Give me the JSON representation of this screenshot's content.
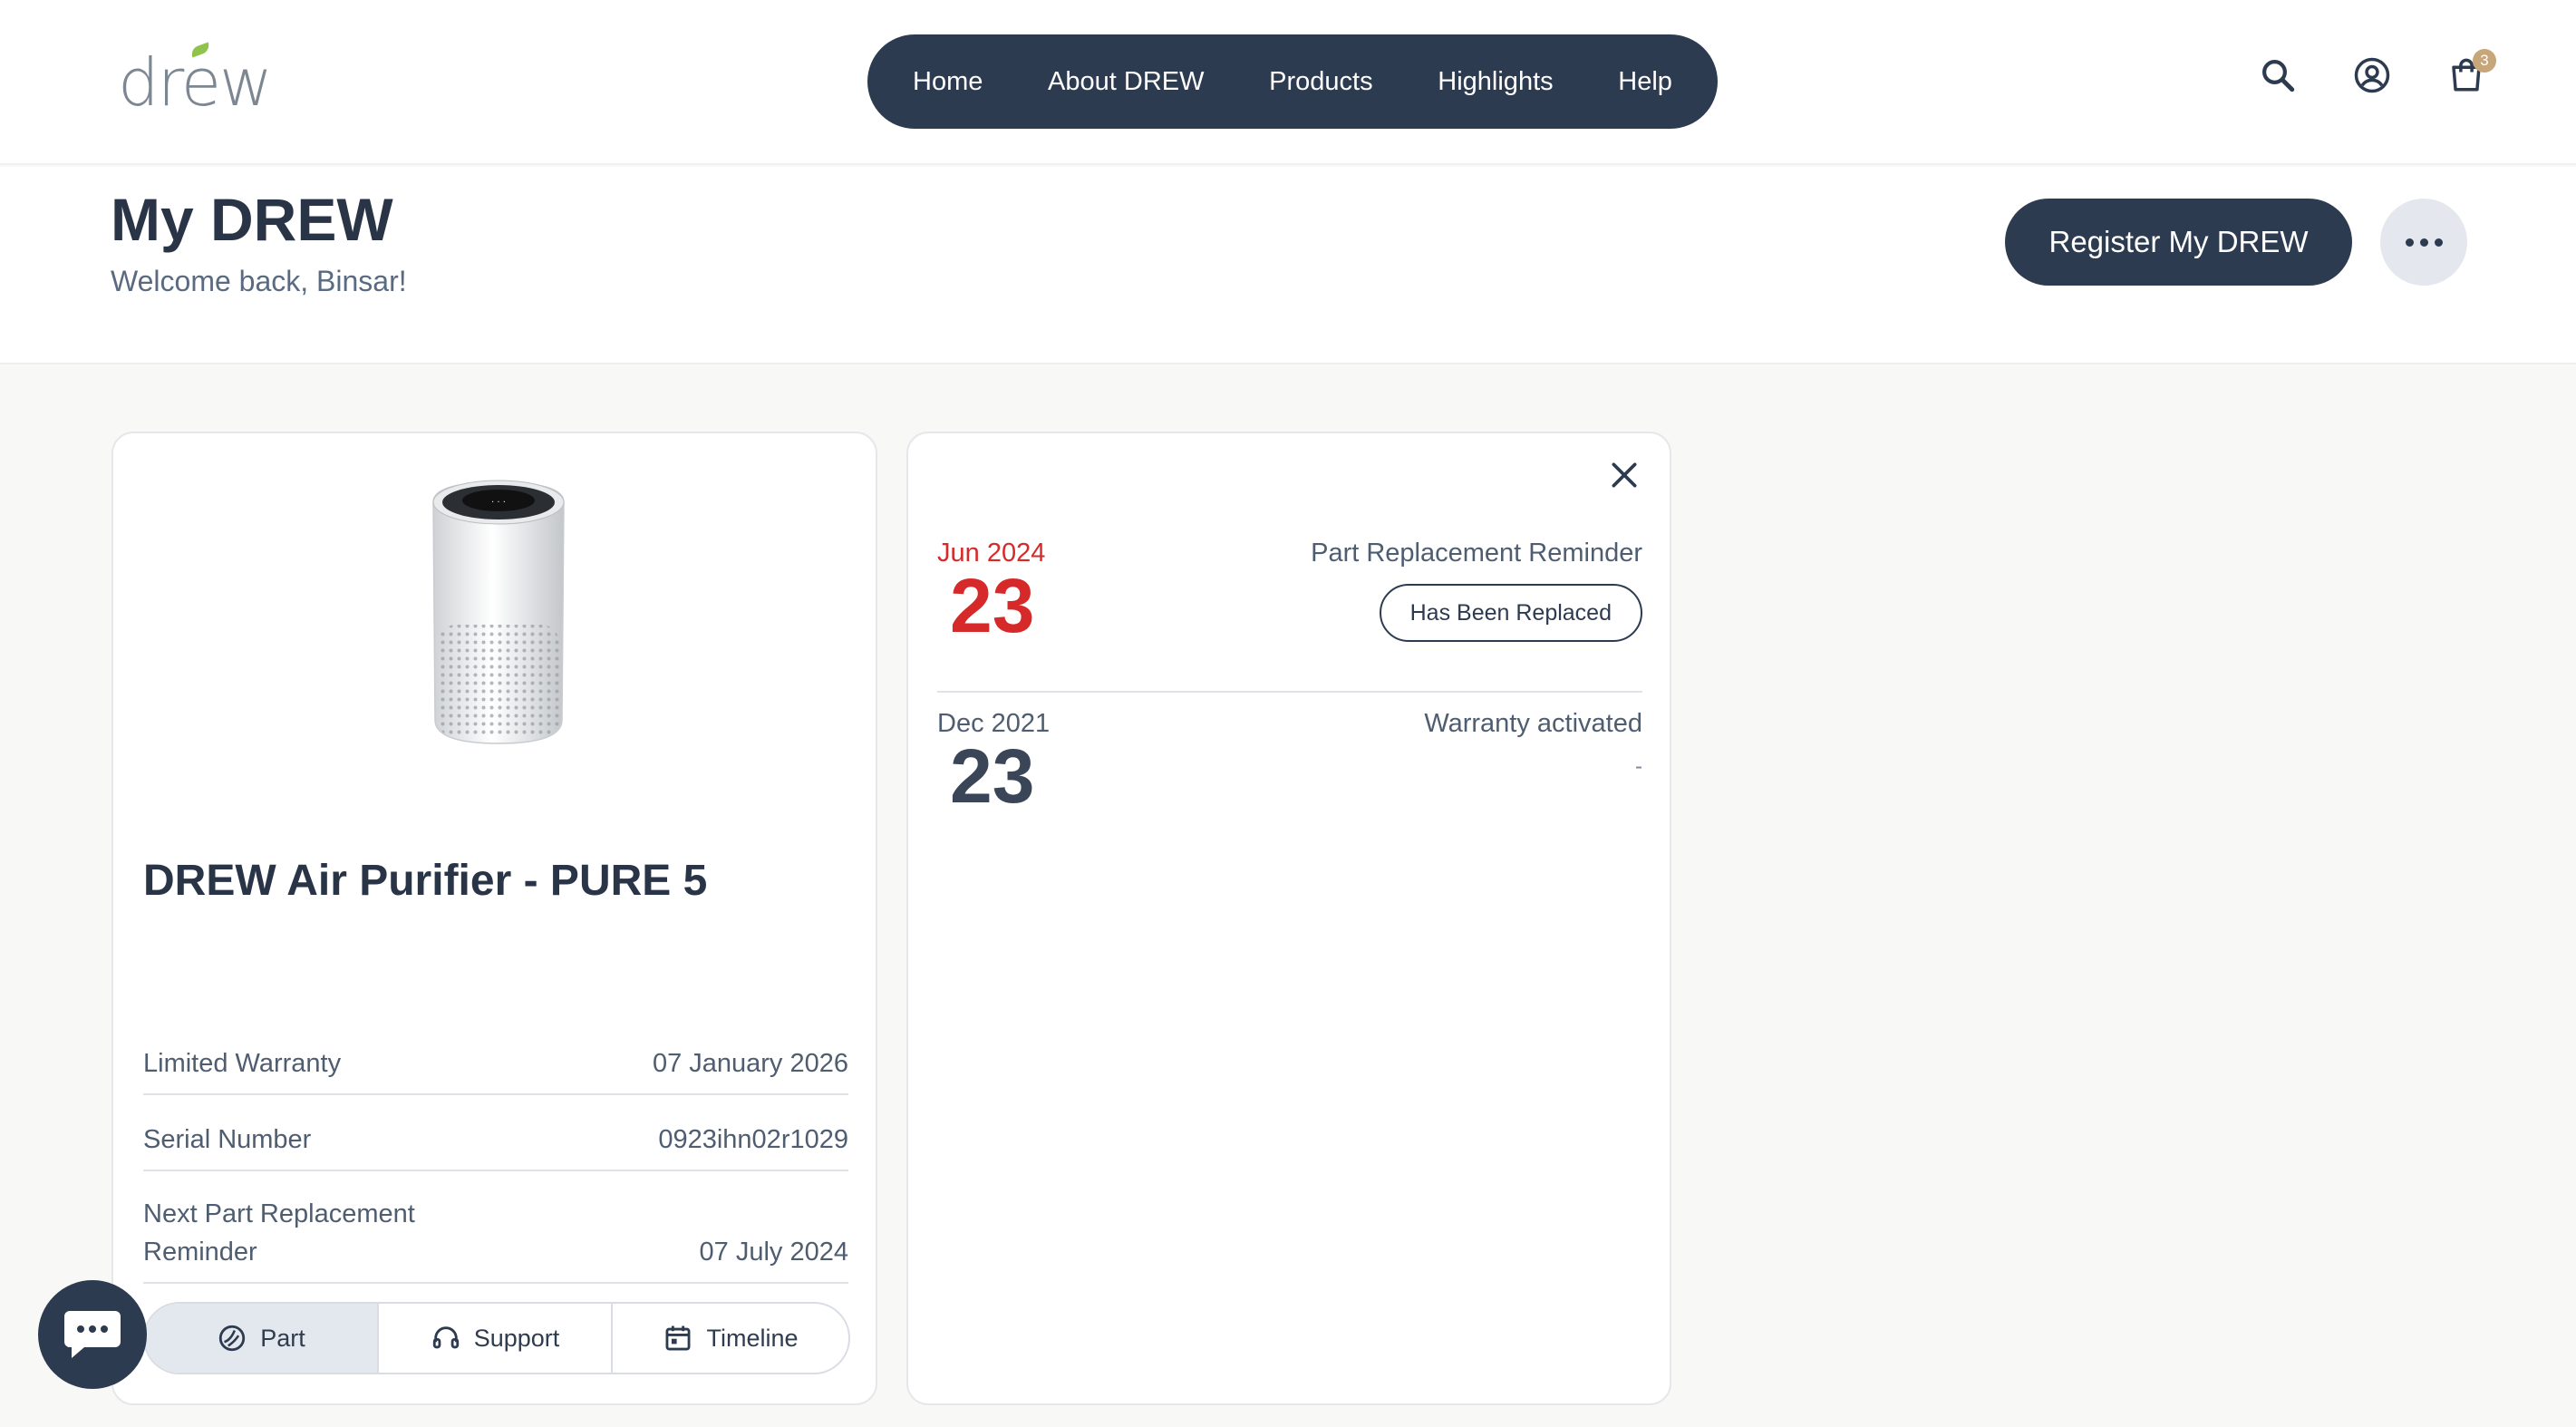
{
  "brand": {
    "logo_text": "drew"
  },
  "nav": {
    "items": [
      {
        "label": "Home"
      },
      {
        "label": "About DREW"
      },
      {
        "label": "Products"
      },
      {
        "label": "Highlights"
      },
      {
        "label": "Help"
      }
    ]
  },
  "header": {
    "cart_count": "3",
    "icons": [
      "search-icon",
      "account-icon",
      "cart-icon"
    ]
  },
  "page": {
    "title": "My DREW",
    "welcome": "Welcome back, Binsar!",
    "register_label": "Register My DREW"
  },
  "product": {
    "name": "DREW Air Purifier - PURE 5",
    "rows": [
      {
        "label": "Limited Warranty",
        "value": "07 January 2026"
      },
      {
        "label": "Serial Number",
        "value": "0923ihn02r1029"
      },
      {
        "label": "Next Part Replacement Reminder",
        "value": "07 July 2024"
      }
    ],
    "tabs": [
      {
        "label": "Part",
        "icon": "filter-part-icon"
      },
      {
        "label": "Support",
        "icon": "headset-icon"
      },
      {
        "label": "Timeline",
        "icon": "calendar-icon"
      }
    ]
  },
  "timeline": {
    "entries": [
      {
        "month": "Jun 2024",
        "day": "23",
        "title": "Part Replacement Reminder",
        "action": "Has Been Replaced",
        "accent": "#d62a2a"
      },
      {
        "month": "Dec 2021",
        "day": "23",
        "title": "Warranty activated",
        "detail": "-"
      }
    ]
  },
  "colors": {
    "primary": "#2d3b50",
    "accent_red": "#d62a2a",
    "badge": "#c7a77a"
  }
}
